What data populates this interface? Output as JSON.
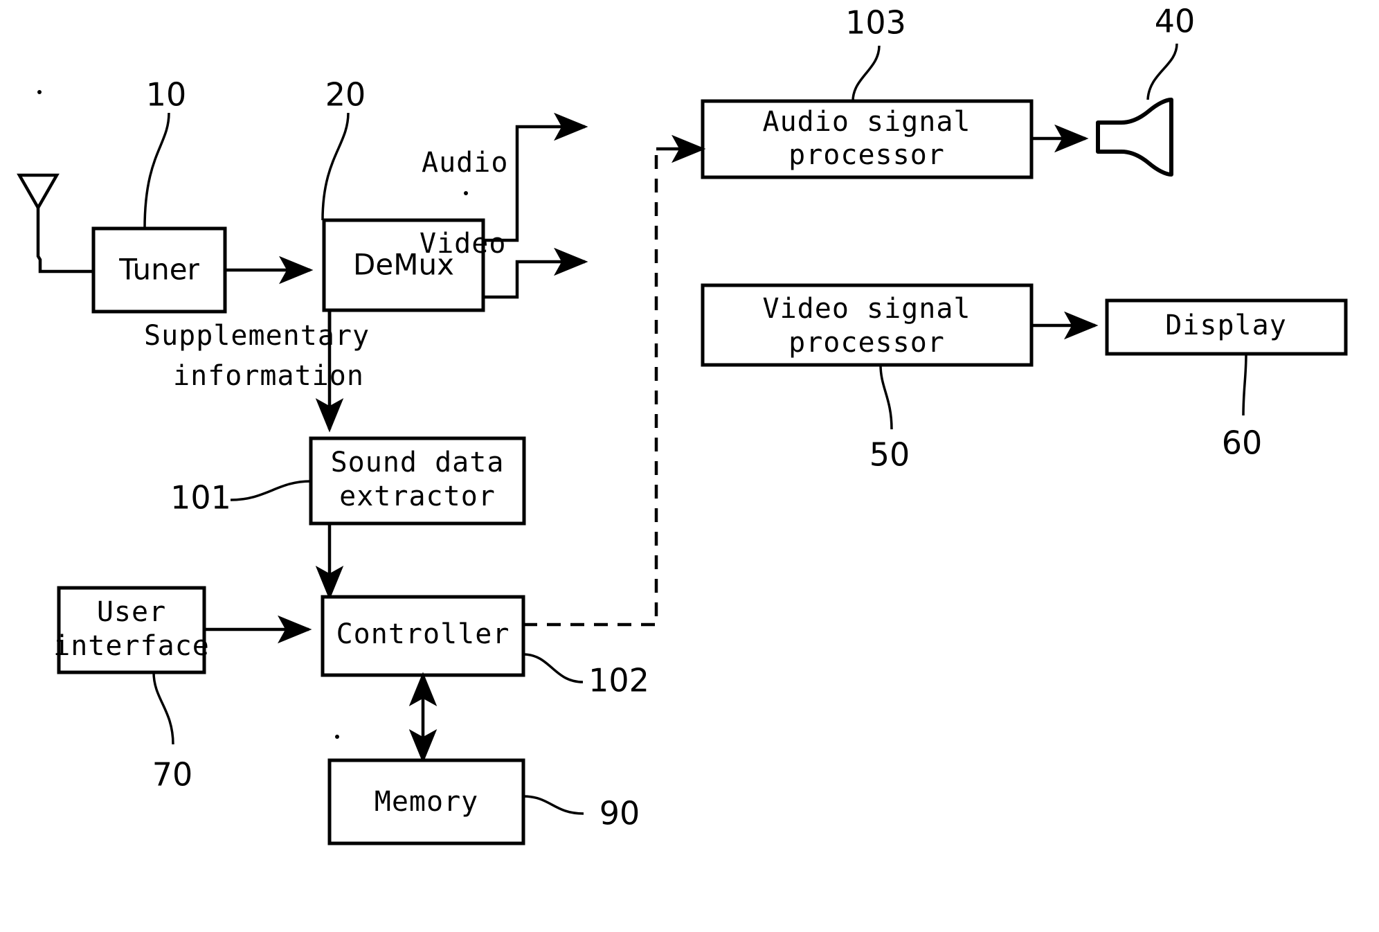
{
  "figure": {
    "kind": "patent-block-diagram",
    "background_color": "#ffffff",
    "line_color": "#000000"
  },
  "blocks": {
    "tuner": {
      "label": "Tuner",
      "ref": "10"
    },
    "demux": {
      "label": "DeMux",
      "ref": "20"
    },
    "audio_processor": {
      "label_line1": "Audio signal",
      "label_line2": "processor",
      "ref": "103"
    },
    "speaker": {
      "label": "",
      "ref": "40",
      "icon": "speaker-icon"
    },
    "video_processor": {
      "label_line1": "Video signal",
      "label_line2": "processor",
      "ref": "50"
    },
    "display": {
      "label": "Display",
      "ref": "60"
    },
    "sound_extractor": {
      "label_line1": "Sound data",
      "label_line2": "extractor",
      "ref": "101"
    },
    "user_interface": {
      "label_line1": "User",
      "label_line2": "interface",
      "ref": "70"
    },
    "controller": {
      "label": "Controller",
      "ref": "102"
    },
    "memory": {
      "label": "Memory",
      "ref": "90"
    },
    "antenna": {
      "label": "",
      "icon": "antenna-icon"
    }
  },
  "signal_labels": {
    "audio": "Audio",
    "video": "Video",
    "supplementary_line1": "Supplementary",
    "supplementary_line2": "information"
  },
  "reference_numerals": {
    "antenna_tuner": "10",
    "demux": "20",
    "speaker": "40",
    "video_processor": "50",
    "display": "60",
    "user_interface": "70",
    "memory": "90",
    "sound_extractor": "101",
    "controller": "102",
    "audio_processor": "103"
  }
}
